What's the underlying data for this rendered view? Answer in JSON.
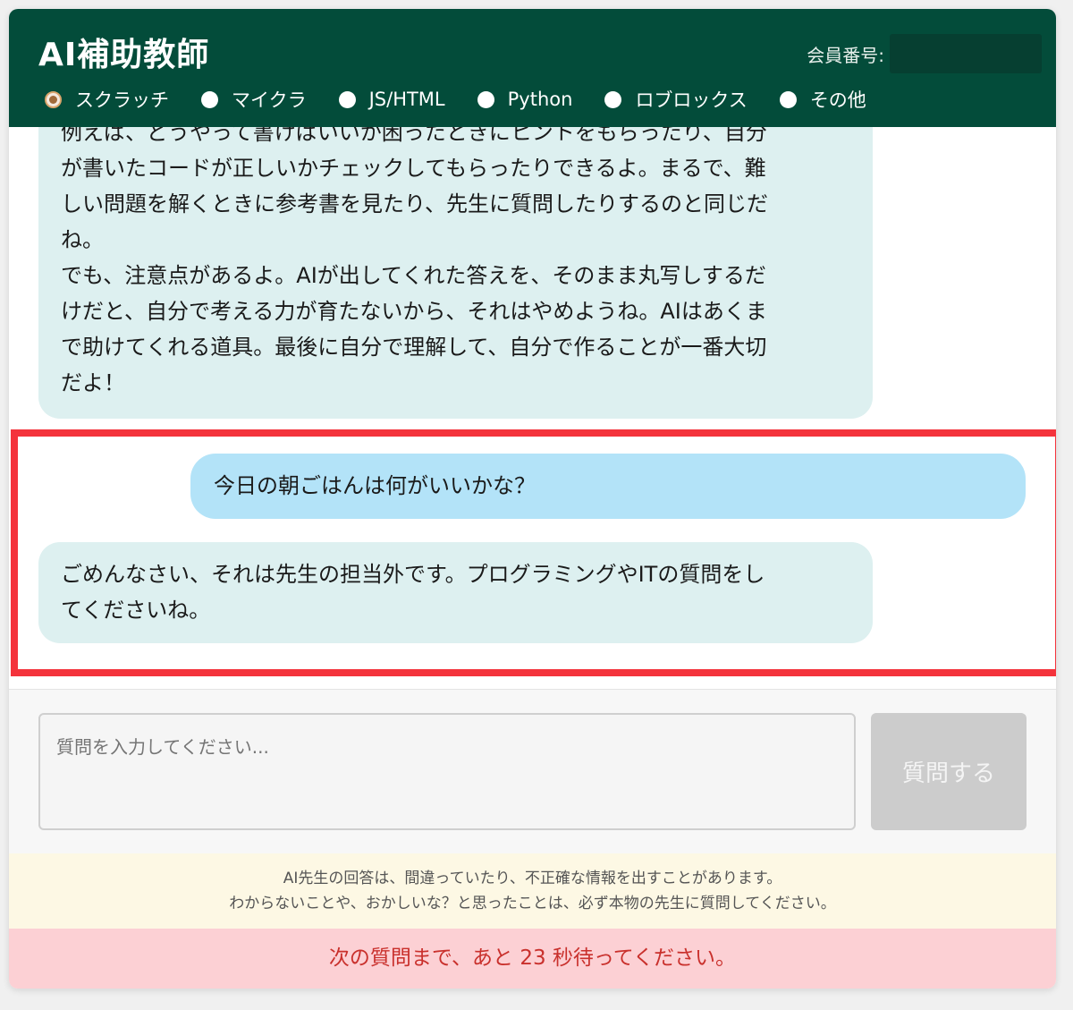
{
  "header": {
    "title": "AI補助教師",
    "member_label": "会員番号:",
    "member_value": ""
  },
  "languages": {
    "selected": "スクラッチ",
    "options": [
      "スクラッチ",
      "マイクラ",
      "JS/HTML",
      "Python",
      "ロブロックス",
      "その他"
    ]
  },
  "chat": {
    "ai_message_1": [
      "例えば、どうやって書けばいいか困ったときにヒントをもらったり、自分",
      "が書いたコードが正しいかチェックしてもらったりできるよ。まるで、難",
      "しい問題を解くときに参考書を見たり、先生に質問したりするのと同じだ",
      "ね。",
      "でも、注意点があるよ。AIが出してくれた答えを、そのまま丸写しするだ",
      "けだと、自分で考える力が育たないから、それはやめようね。AIはあくま",
      "で助けてくれる道具。最後に自分で理解して、自分で作ることが一番大切",
      "だよ！"
    ],
    "user_message": "今日の朝ごはんは何がいいかな？",
    "ai_message_2": [
      "ごめんなさい、それは先生の担当外です。プログラミングやITの質問をし",
      "てくださいね。"
    ]
  },
  "input": {
    "placeholder": "質問を入力してください...",
    "submit_label": "質問する"
  },
  "notice": {
    "line1": "AI先生の回答は、間違っていたり、不正確な情報を出すことがあります。",
    "line2": "わからないことや、おかしいな？と思ったことは、必ず本物の先生に質問してください。"
  },
  "cooldown": {
    "message": "次の質問まで、あと 23 秒待ってください。"
  },
  "colors": {
    "header_bg": "#034c3a",
    "ai_bubble": "#ddf0f0",
    "user_bubble": "#b3e3f8",
    "highlight": "#f4333c",
    "cooldown_bg": "#fcd0d4",
    "cooldown_text": "#c9302c"
  }
}
